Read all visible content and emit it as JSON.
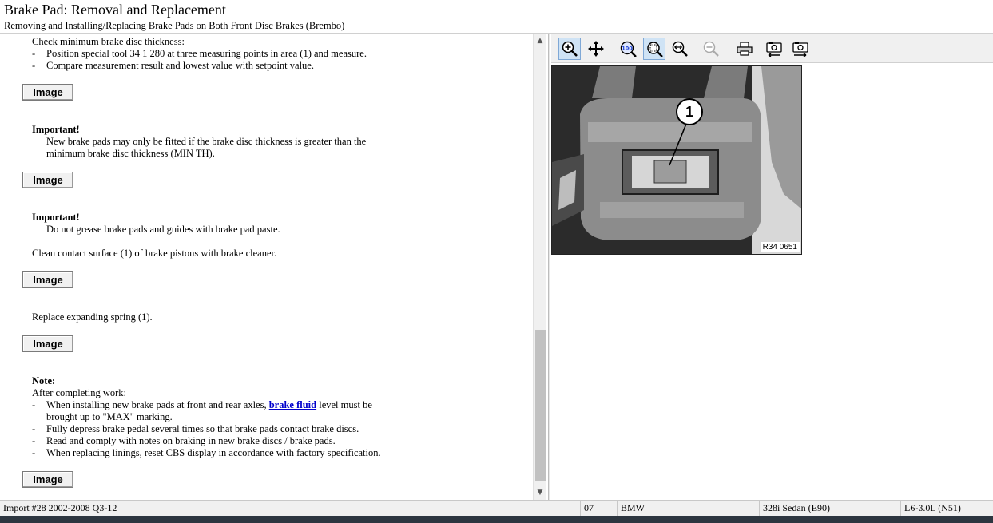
{
  "header": {
    "title": "Brake Pad:  Removal and Replacement",
    "subtitle": "Removing and Installing/Replacing Brake Pads on Both Front Disc Brakes (Brembo)"
  },
  "content": {
    "check_heading": "Check minimum brake disc thickness:",
    "check_items": [
      "Position special tool 34 1 280 at three measuring points in area (1) and measure.",
      "Compare measurement result and lowest value with setpoint value."
    ],
    "image_button_label": "Image",
    "important1_heading": "Important!",
    "important1_lines": [
      "New brake pads may only be fitted if the brake disc thickness is greater than the",
      "minimum brake disc thickness (MIN TH)."
    ],
    "important2_heading": "Important!",
    "important2_text": "Do not grease brake pads and guides with brake pad paste.",
    "clean_text": "Clean contact surface (1) of brake pistons with brake cleaner.",
    "replace_text": "Replace expanding spring (1).",
    "note_heading": "Note:",
    "note_intro": "After completing work:",
    "note_item1_before": "When installing new brake pads at front and rear axles, ",
    "note_item1_link": "brake fluid",
    "note_item1_after": " level must be",
    "note_item1_cont": "brought up to \"MAX\" marking.",
    "note_items": [
      "Fully depress brake pedal several times so that brake pads contact brake discs.",
      "Read and comply with notes on braking in new brake discs / brake pads.",
      "When replacing linings, reset CBS display in accordance with factory specification."
    ],
    "bullet": "-"
  },
  "toolbar": {
    "tools": [
      "zoom-in",
      "pan",
      "actual-size",
      "zoom-to-fit",
      "zoom-width",
      "zoom-out",
      "print",
      "prev-image",
      "next-image"
    ]
  },
  "image": {
    "callout_label": "1",
    "code": "R34 0651"
  },
  "status": {
    "import": "Import #28 2002-2008 Q3-12",
    "code": "07",
    "make": "BMW",
    "model": "328i Sedan (E90)",
    "engine": "L6-3.0L (N51)"
  }
}
